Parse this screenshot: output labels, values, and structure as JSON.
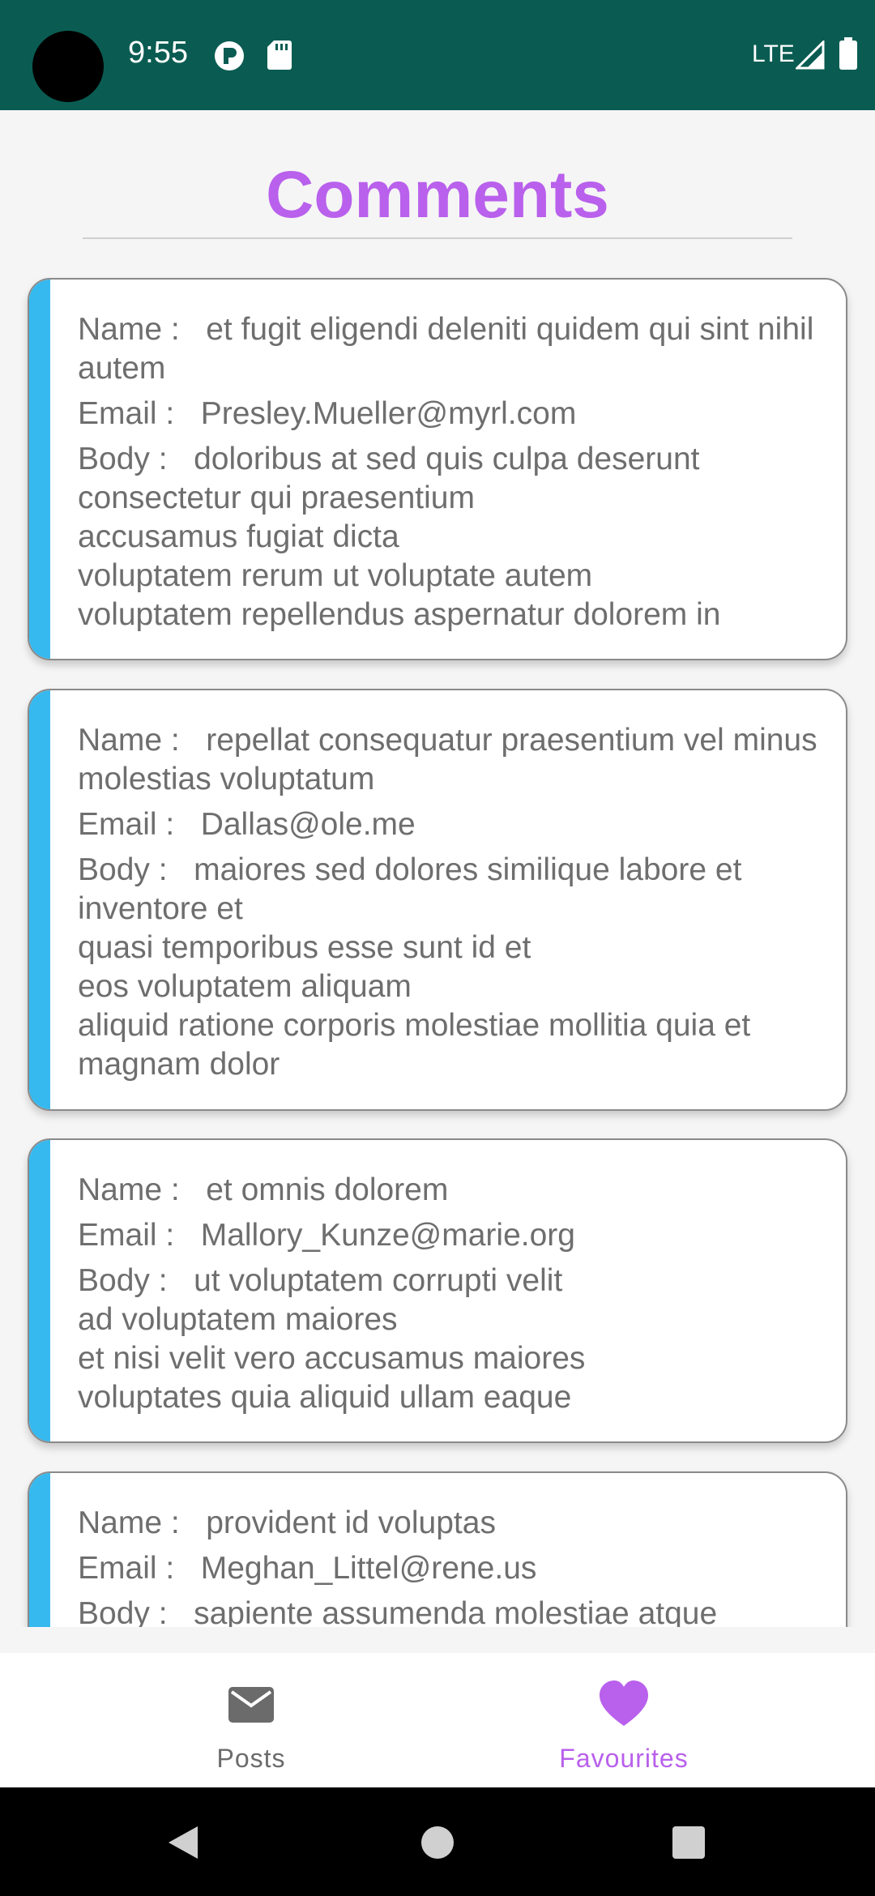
{
  "status_bar": {
    "time": "9:55",
    "network": "LTE",
    "icons": [
      "p-badge-icon",
      "sd-card-icon",
      "signal-icon",
      "battery-icon"
    ]
  },
  "header": {
    "title": "Comments"
  },
  "labels": {
    "name": "Name :   ",
    "email": "Email :   ",
    "body": "Body :   "
  },
  "comments": [
    {
      "name": "et fugit eligendi deleniti quidem qui sint nihil autem",
      "email": "Presley.Mueller@myrl.com",
      "body": "doloribus at sed quis culpa deserunt consectetur qui praesentium\naccusamus fugiat dicta\nvoluptatem rerum ut voluptate autem\nvoluptatem repellendus aspernatur dolorem in"
    },
    {
      "name": "repellat consequatur praesentium vel minus molestias voluptatum",
      "email": "Dallas@ole.me",
      "body": "maiores sed dolores similique labore et inventore et\nquasi temporibus esse sunt id et\neos voluptatem aliquam\naliquid ratione corporis molestiae mollitia quia et magnam dolor"
    },
    {
      "name": "et omnis dolorem",
      "email": "Mallory_Kunze@marie.org",
      "body": "ut voluptatem corrupti velit\nad voluptatem maiores\net nisi velit vero accusamus maiores\nvoluptates quia aliquid ullam eaque"
    },
    {
      "name": "provident id voluptas",
      "email": "Meghan_Littel@rene.us",
      "body": "sapiente assumenda molestiae atque"
    }
  ],
  "bottom_nav": {
    "items": [
      {
        "label": "Posts",
        "icon": "mail-icon",
        "color": "#6b6b6b",
        "active": false
      },
      {
        "label": "Favourites",
        "icon": "heart-icon",
        "color": "#b960ec",
        "active": true
      }
    ]
  },
  "colors": {
    "status_bar": "#0a5c52",
    "accent_purple": "#b960ec",
    "card_stripe": "#35b9ef",
    "text": "#6e6e6e"
  }
}
